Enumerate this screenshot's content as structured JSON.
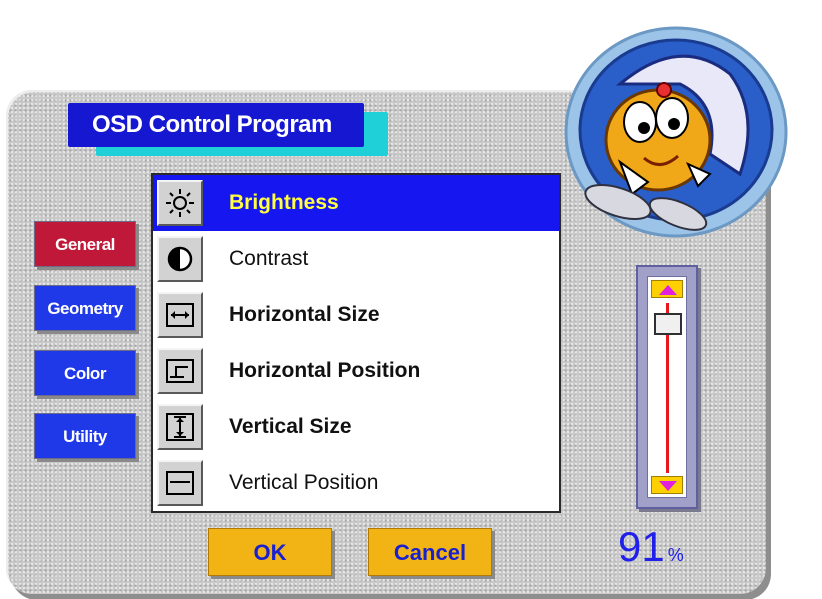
{
  "title": "OSD Control Program",
  "tabs": [
    {
      "label": "General",
      "selected": true
    },
    {
      "label": "Geometry",
      "selected": false
    },
    {
      "label": "Color",
      "selected": false
    },
    {
      "label": "Utility",
      "selected": false
    }
  ],
  "items": [
    {
      "label": "Brightness",
      "icon": "sun-icon",
      "selected": true
    },
    {
      "label": "Contrast",
      "icon": "contrast-icon",
      "selected": false
    },
    {
      "label": "Horizontal Size",
      "icon": "horizontal-size-icon",
      "selected": false
    },
    {
      "label": "Horizontal Position",
      "icon": "horizontal-position-icon",
      "selected": false
    },
    {
      "label": "Vertical Size",
      "icon": "vertical-size-icon",
      "selected": false
    },
    {
      "label": "Vertical Position",
      "icon": "vertical-position-icon",
      "selected": false
    }
  ],
  "buttons": {
    "ok": "OK",
    "cancel": "Cancel"
  },
  "slider": {
    "value": "91",
    "unit": "%",
    "level": 0.91
  },
  "colors": {
    "title_bg": "#1518d0",
    "title_shadow": "#1fd0d8",
    "tab_active": "#c01838",
    "tab_inactive": "#1f38e8",
    "selection": "#1616f0",
    "selected_text": "#ffff40",
    "button_bg": "#f2b414",
    "button_text": "#1820d0",
    "slider_line": "#e81818",
    "readout": "#2020e8"
  }
}
